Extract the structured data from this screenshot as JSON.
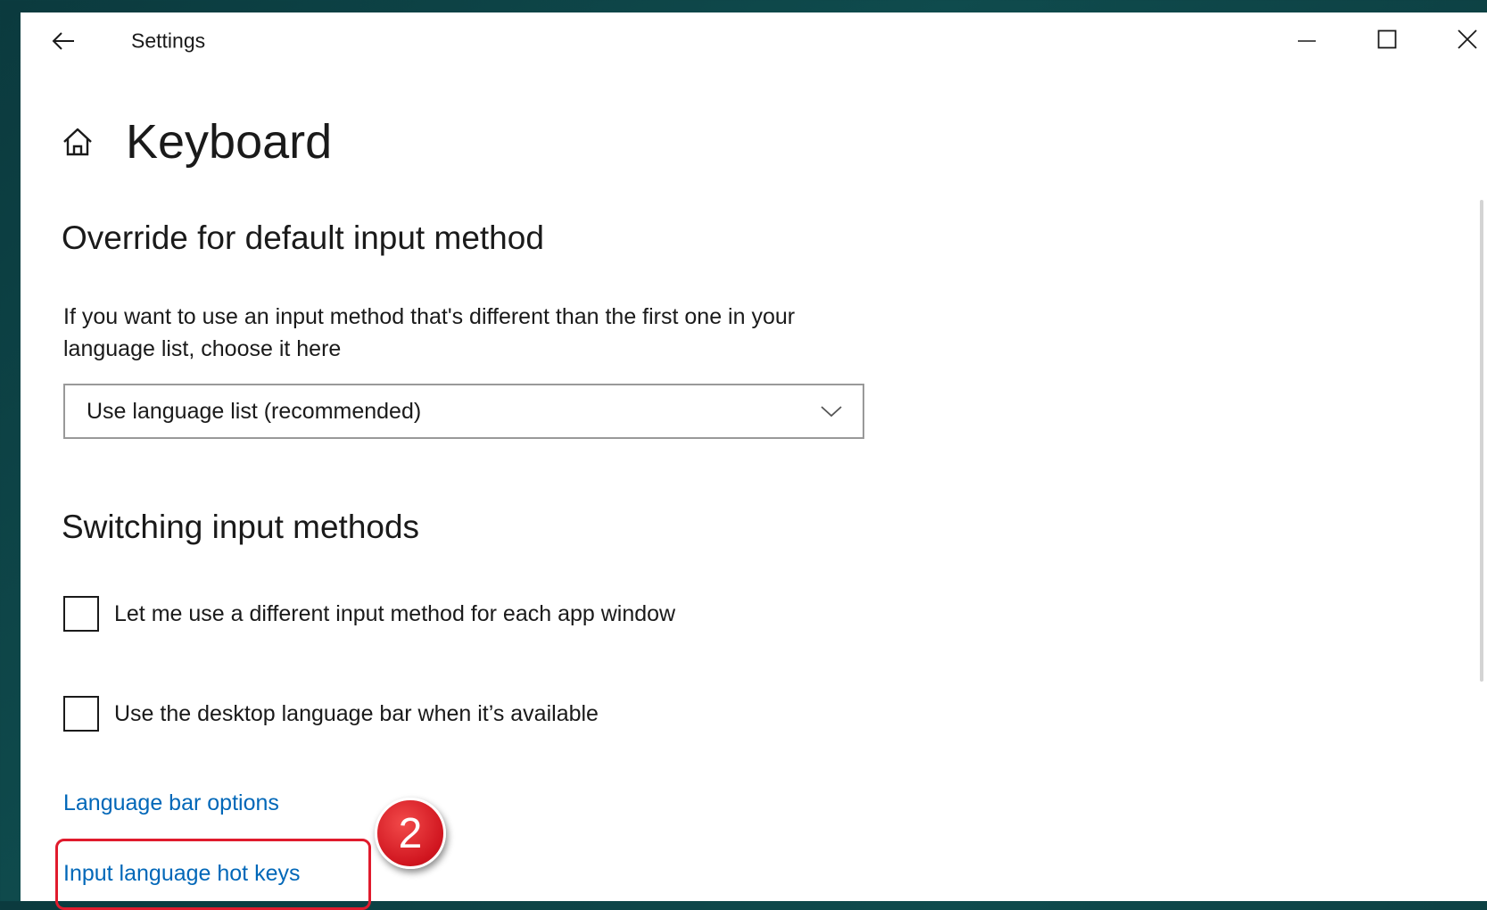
{
  "window": {
    "title": "Settings",
    "back_icon": "arrow-left-icon",
    "controls": [
      "minimize-icon",
      "maximize-icon",
      "close-icon"
    ]
  },
  "page": {
    "title": "Keyboard",
    "home_icon": "home-icon"
  },
  "override_section": {
    "heading": "Override for default input method",
    "description": "If you want to use an input method that's different than the first one in your language list, choose it here",
    "dropdown": {
      "selected": "Use language list (recommended)",
      "chevron_icon": "chevron-down-icon"
    }
  },
  "switching_section": {
    "heading": "Switching input methods",
    "checkboxes": [
      {
        "label": "Let me use a different input method for each app window",
        "checked": false
      },
      {
        "label": "Use the desktop language bar when it’s available",
        "checked": false
      }
    ]
  },
  "links": {
    "language_bar_options": "Language bar options",
    "input_language_hot_keys": "Input language hot keys"
  },
  "annotation": {
    "step_number": "2",
    "color": "#e01b2d"
  },
  "colors": {
    "link": "#0067b8",
    "text": "#1a1a1a",
    "background": "#ffffff"
  }
}
